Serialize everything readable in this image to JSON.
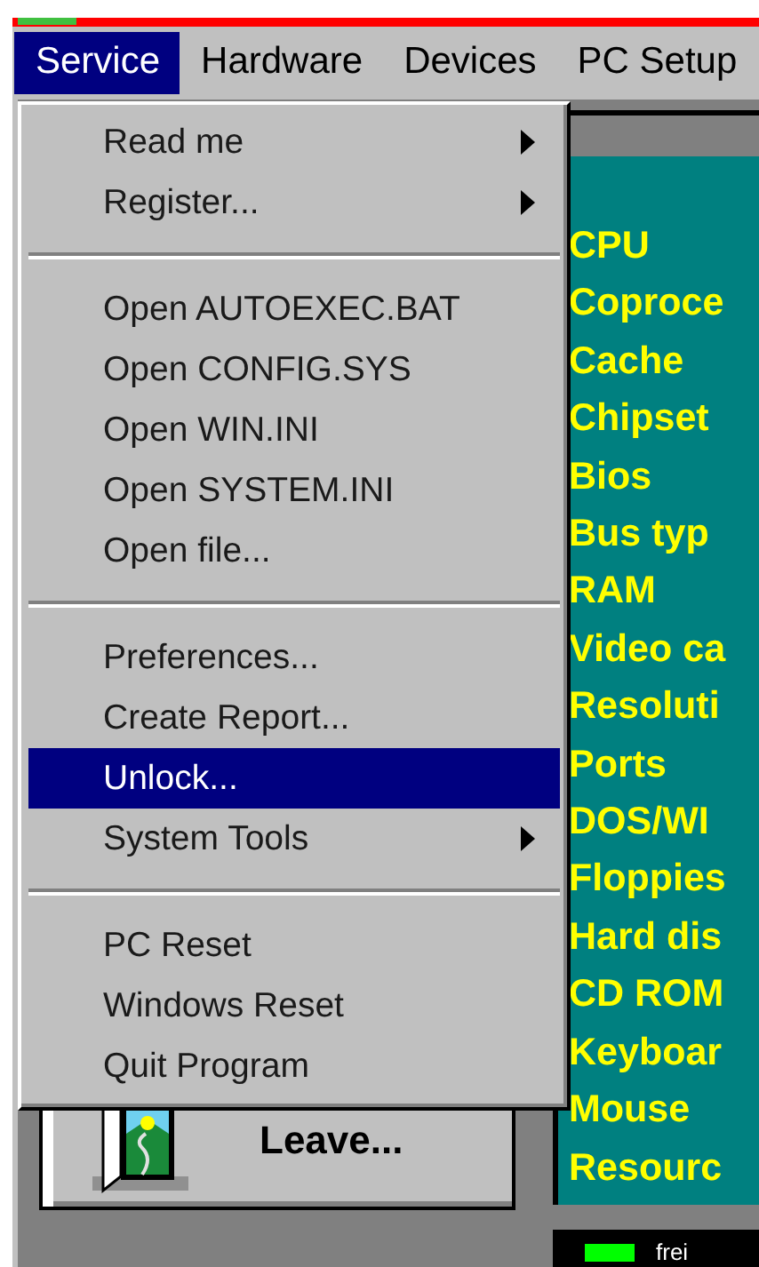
{
  "menu_bar": [
    {
      "label": "Service",
      "selected": true
    },
    {
      "label": "Hardware",
      "selected": false
    },
    {
      "label": "Devices",
      "selected": false
    },
    {
      "label": "PC Setup",
      "selected": false
    }
  ],
  "service_menu": [
    {
      "kind": "item",
      "label": "Read me",
      "submenu": true,
      "selected": false
    },
    {
      "kind": "item",
      "label": "Register...",
      "submenu": true,
      "selected": false
    },
    {
      "kind": "separator"
    },
    {
      "kind": "item",
      "label": "Open AUTOEXEC.BAT",
      "submenu": false,
      "selected": false
    },
    {
      "kind": "item",
      "label": "Open CONFIG.SYS",
      "submenu": false,
      "selected": false
    },
    {
      "kind": "item",
      "label": "Open WIN.INI",
      "submenu": false,
      "selected": false
    },
    {
      "kind": "item",
      "label": "Open SYSTEM.INI",
      "submenu": false,
      "selected": false
    },
    {
      "kind": "item",
      "label": "Open file...",
      "submenu": false,
      "selected": false
    },
    {
      "kind": "separator"
    },
    {
      "kind": "item",
      "label": "Preferences...",
      "submenu": false,
      "selected": false
    },
    {
      "kind": "item",
      "label": "Create Report...",
      "submenu": false,
      "selected": false
    },
    {
      "kind": "item",
      "label": "Unlock...",
      "submenu": false,
      "selected": true
    },
    {
      "kind": "item",
      "label": "System Tools",
      "submenu": true,
      "selected": false
    },
    {
      "kind": "separator"
    },
    {
      "kind": "item",
      "label": "PC Reset",
      "submenu": false,
      "selected": false
    },
    {
      "kind": "item",
      "label": "Windows Reset",
      "submenu": false,
      "selected": false
    },
    {
      "kind": "item",
      "label": "Quit Program",
      "submenu": false,
      "selected": false
    }
  ],
  "info_list": [
    "CPU",
    "Coproce",
    "Cache",
    "Chipset",
    "Bios",
    "Bus typ",
    "RAM",
    "Video ca",
    "Resoluti",
    "Ports",
    "DOS/WI",
    "Floppies",
    "Hard dis",
    "CD ROM",
    "Keyboar",
    "Mouse",
    "Resourc"
  ],
  "leave_button": {
    "label": "Leave..."
  },
  "status": {
    "label": "frei"
  }
}
